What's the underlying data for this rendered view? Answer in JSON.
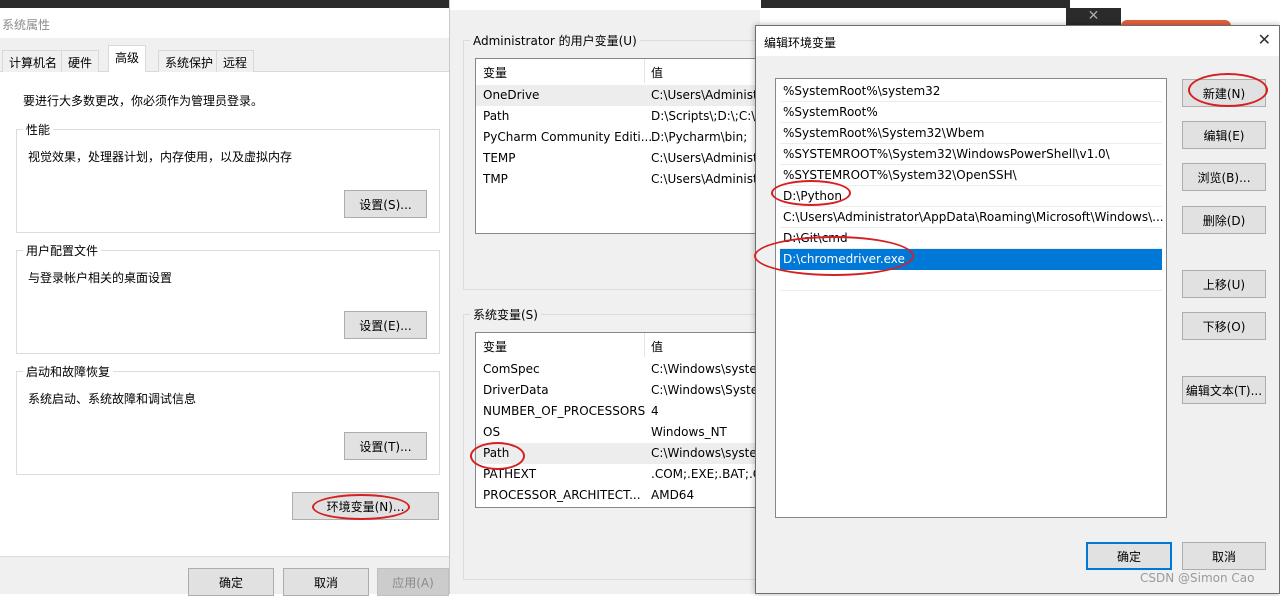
{
  "system_properties": {
    "title": "系统属性",
    "tabs": [
      {
        "label": "计算机名",
        "active": false
      },
      {
        "label": "硬件",
        "active": false
      },
      {
        "label": "高级",
        "active": true
      },
      {
        "label": "系统保护",
        "active": false
      },
      {
        "label": "远程",
        "active": false
      }
    ],
    "admin_notice": "要进行大多数更改，你必须作为管理员登录。",
    "performance": {
      "label": "性能",
      "description": "视觉效果，处理器计划，内存使用，以及虚拟内存",
      "button": "设置(S)..."
    },
    "user_profiles": {
      "label": "用户配置文件",
      "description": "与登录帐户相关的桌面设置",
      "button": "设置(E)..."
    },
    "startup_recovery": {
      "label": "启动和故障恢复",
      "description": "系统启动、系统故障和调试信息",
      "button": "设置(T)..."
    },
    "env_button": "环境变量(N)...",
    "ok": "确定",
    "cancel": "取消",
    "apply": "应用(A)"
  },
  "environment_variables": {
    "user_section": "Administrator 的用户变量(U)",
    "system_section": "系统变量(S)",
    "col_variable": "变量",
    "col_value": "值",
    "user_vars": [
      {
        "name": "OneDrive",
        "value": "C:\\Users\\Administ"
      },
      {
        "name": "Path",
        "value": "D:\\Scripts\\;D:\\;C:\\U"
      },
      {
        "name": "PyCharm Community Editi...",
        "value": "D:\\Pycharm\\bin;"
      },
      {
        "name": "TEMP",
        "value": "C:\\Users\\Administ"
      },
      {
        "name": "TMP",
        "value": "C:\\Users\\Administ"
      }
    ],
    "system_vars": [
      {
        "name": "ComSpec",
        "value": "C:\\Windows\\syster"
      },
      {
        "name": "DriverData",
        "value": "C:\\Windows\\Syster"
      },
      {
        "name": "NUMBER_OF_PROCESSORS",
        "value": "4"
      },
      {
        "name": "OS",
        "value": "Windows_NT"
      },
      {
        "name": "Path",
        "value": "C:\\Windows\\syster"
      },
      {
        "name": "PATHEXT",
        "value": ".COM;.EXE;.BAT;.C"
      },
      {
        "name": "PROCESSOR_ARCHITECT...",
        "value": "AMD64"
      }
    ]
  },
  "edit_env": {
    "title": "编辑环境变量",
    "entries": [
      "%SystemRoot%\\system32",
      "%SystemRoot%",
      "%SystemRoot%\\System32\\Wbem",
      "%SYSTEMROOT%\\System32\\WindowsPowerShell\\v1.0\\",
      "%SYSTEMROOT%\\System32\\OpenSSH\\",
      "D:\\Python",
      "C:\\Users\\Administrator\\AppData\\Roaming\\Microsoft\\Windows\\...",
      "D:\\Git\\cmd",
      "D:\\chromedriver.exe"
    ],
    "selected_index": 8,
    "buttons": {
      "new": "新建(N)",
      "edit": "编辑(E)",
      "browse": "浏览(B)...",
      "delete": "删除(D)",
      "move_up": "上移(U)",
      "move_down": "下移(O)",
      "edit_text": "编辑文本(T)...",
      "ok": "确定",
      "cancel": "取消"
    },
    "close_glyph": "✕"
  },
  "background_close_glyph": "✕",
  "watermark": "CSDN @Simon Cao"
}
